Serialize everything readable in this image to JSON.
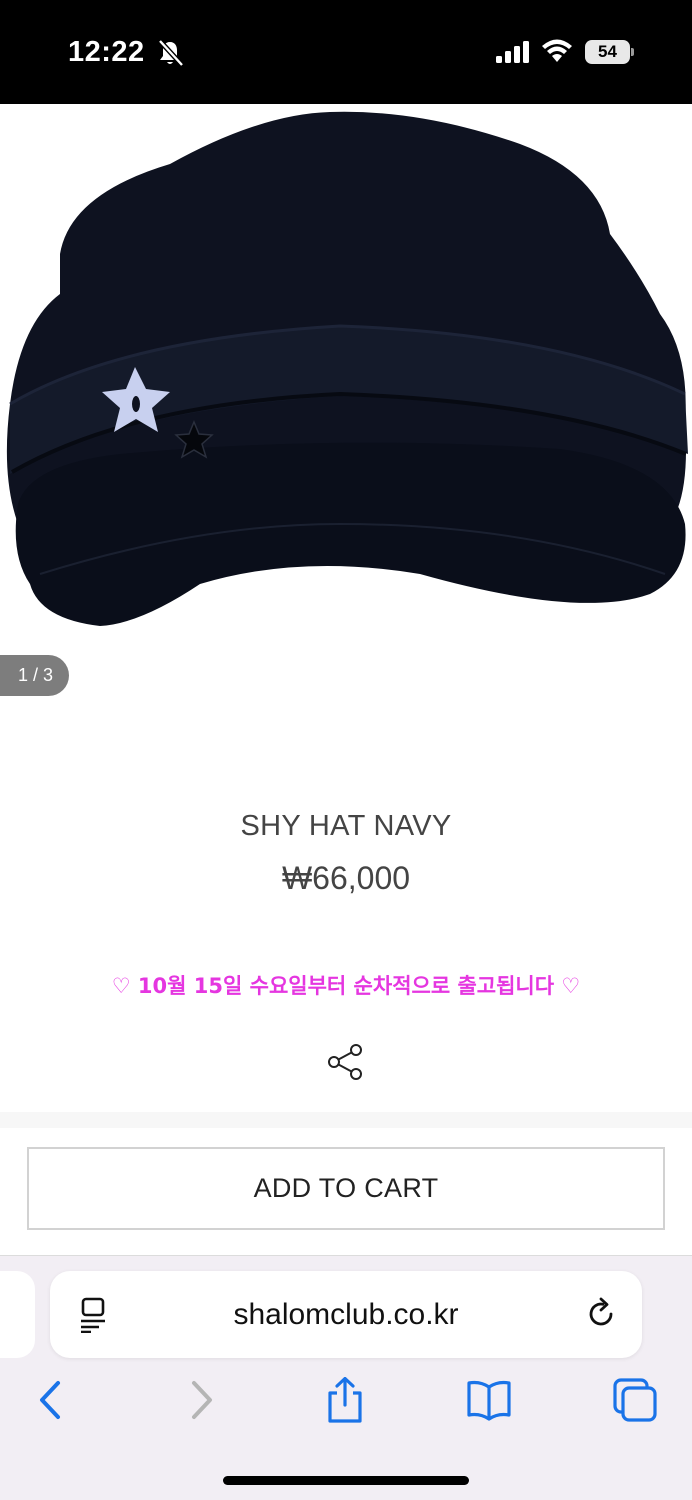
{
  "status_bar": {
    "time": "12:22",
    "battery": "54",
    "icons": [
      "bell-slash-icon",
      "cellular-signal-icon",
      "wifi-icon",
      "battery-icon"
    ]
  },
  "product": {
    "image_counter": "1 / 3",
    "name": "SHY HAT NAVY",
    "price": "₩66,000",
    "shipping_notice": "♡ 10월 15일 수요일부터 순차적으로 출고됩니다 ♡",
    "add_to_cart_label": "ADD TO CART"
  },
  "browser": {
    "url": "shalomclub.co.kr",
    "toolbar": [
      "back-icon",
      "forward-icon",
      "share-icon",
      "bookmarks-icon",
      "tabs-icon"
    ]
  },
  "colors": {
    "accent": "#e536e0",
    "link_blue": "#1a73e8",
    "hat_navy": "#0e1220"
  }
}
